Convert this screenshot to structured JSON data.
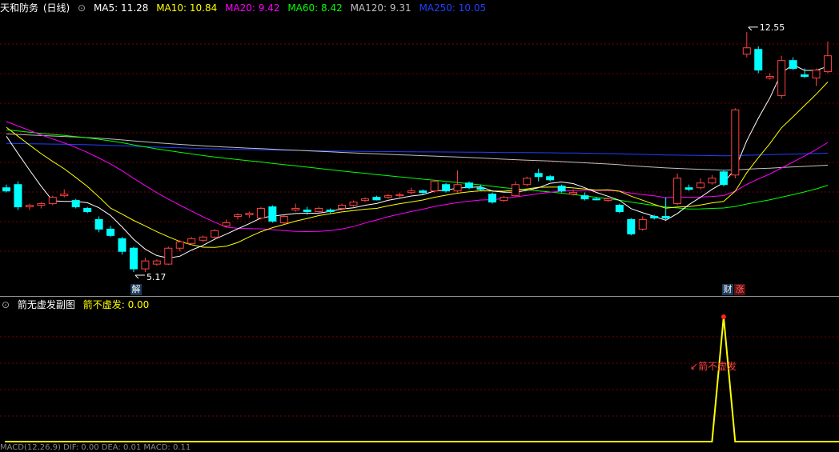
{
  "header": {
    "stock_name": "天和防务",
    "period": "(日线)",
    "ma_items": [
      {
        "label": "MA5: 11.28",
        "color": "#ffffff"
      },
      {
        "label": "MA10: 10.84",
        "color": "#ffff00"
      },
      {
        "label": "MA20: 9.42",
        "color": "#ff00ff"
      },
      {
        "label": "MA60: 8.42",
        "color": "#00ff00"
      },
      {
        "label": "MA120: 9.31",
        "color": "#c0c0c0"
      },
      {
        "label": "MA250: 10.05",
        "color": "#2040ff"
      }
    ]
  },
  "annotations": {
    "high_label": "12.55",
    "low_label": "5.17",
    "tag_jie": "解",
    "tag_cai": "财",
    "tag_zhang": "涨"
  },
  "sub_header": {
    "indicator_name": "箭无虚发副图",
    "value_label": "箭不虚发: 0.00",
    "signal_label": "箭不虚发"
  },
  "footer": {
    "text": "MACD(12,26,9)  DIF: 0.00  DEA: 0.01  MACD: 0.11"
  },
  "colors": {
    "up": "#ff4040",
    "down": "#00ffff",
    "grid": "#7a0000",
    "signal": "#ffff00"
  },
  "chart_data": {
    "type": "candlestick",
    "price_range": [
      4.7,
      13.0
    ],
    "ohlc": [
      [
        7.6,
        7.7,
        7.45,
        7.5
      ],
      [
        7.7,
        7.8,
        6.9,
        7.0
      ],
      [
        7.0,
        7.1,
        6.9,
        7.05
      ],
      [
        7.05,
        7.15,
        6.95,
        7.1
      ],
      [
        7.1,
        7.35,
        7.05,
        7.3
      ],
      [
        7.35,
        7.55,
        7.3,
        7.4
      ],
      [
        7.2,
        7.25,
        6.95,
        7.0
      ],
      [
        6.95,
        7.0,
        6.8,
        6.85
      ],
      [
        6.6,
        6.7,
        6.2,
        6.3
      ],
      [
        6.3,
        6.4,
        6.05,
        6.1
      ],
      [
        6.0,
        6.05,
        5.5,
        5.6
      ],
      [
        5.7,
        5.75,
        4.95,
        5.05
      ],
      [
        5.05,
        5.4,
        4.95,
        5.3
      ],
      [
        5.2,
        5.35,
        5.15,
        5.3
      ],
      [
        5.2,
        5.75,
        5.17,
        5.7
      ],
      [
        5.7,
        5.95,
        5.6,
        5.9
      ],
      [
        5.85,
        6.05,
        5.8,
        6.0
      ],
      [
        5.95,
        6.1,
        5.9,
        6.05
      ],
      [
        6.05,
        6.3,
        6.0,
        6.25
      ],
      [
        6.4,
        6.6,
        6.35,
        6.5
      ],
      [
        6.7,
        6.8,
        6.6,
        6.75
      ],
      [
        6.75,
        6.85,
        6.65,
        6.8
      ],
      [
        6.65,
        7.0,
        6.6,
        6.95
      ],
      [
        7.0,
        7.05,
        6.5,
        6.55
      ],
      [
        6.5,
        6.75,
        6.45,
        6.7
      ],
      [
        6.9,
        7.1,
        6.85,
        6.95
      ],
      [
        6.9,
        7.0,
        6.75,
        6.85
      ],
      [
        6.85,
        7.0,
        6.8,
        6.95
      ],
      [
        6.9,
        6.95,
        6.8,
        6.85
      ],
      [
        6.95,
        7.1,
        6.9,
        7.05
      ],
      [
        7.05,
        7.2,
        7.0,
        7.15
      ],
      [
        7.2,
        7.3,
        7.15,
        7.25
      ],
      [
        7.3,
        7.35,
        7.2,
        7.22
      ],
      [
        7.3,
        7.4,
        7.25,
        7.35
      ],
      [
        7.35,
        7.45,
        7.3,
        7.38
      ],
      [
        7.45,
        7.6,
        7.4,
        7.5
      ],
      [
        7.5,
        7.55,
        7.4,
        7.45
      ],
      [
        7.5,
        7.85,
        7.45,
        7.8
      ],
      [
        7.7,
        7.75,
        7.45,
        7.5
      ],
      [
        7.5,
        8.15,
        7.45,
        7.7
      ],
      [
        7.75,
        7.8,
        7.55,
        7.6
      ],
      [
        7.6,
        7.7,
        7.5,
        7.55
      ],
      [
        7.4,
        7.45,
        7.1,
        7.15
      ],
      [
        7.2,
        7.35,
        7.15,
        7.3
      ],
      [
        7.35,
        7.8,
        7.3,
        7.7
      ],
      [
        7.7,
        7.95,
        7.65,
        7.9
      ],
      [
        8.05,
        8.2,
        7.8,
        7.95
      ],
      [
        7.95,
        8.0,
        7.8,
        7.85
      ],
      [
        7.65,
        7.7,
        7.45,
        7.5
      ],
      [
        7.4,
        7.55,
        7.35,
        7.45
      ],
      [
        7.35,
        7.45,
        7.2,
        7.25
      ],
      [
        7.25,
        7.3,
        7.2,
        7.22
      ],
      [
        7.2,
        7.3,
        7.15,
        7.25
      ],
      [
        7.05,
        7.1,
        6.8,
        6.85
      ],
      [
        6.6,
        6.65,
        6.1,
        6.15
      ],
      [
        6.3,
        6.7,
        6.25,
        6.6
      ],
      [
        6.7,
        6.75,
        6.6,
        6.65
      ],
      [
        6.7,
        7.3,
        6.6,
        6.65
      ],
      [
        7.1,
        8.05,
        7.05,
        7.9
      ],
      [
        7.6,
        7.7,
        7.5,
        7.55
      ],
      [
        7.6,
        7.9,
        7.55,
        7.75
      ],
      [
        7.75,
        8.0,
        7.7,
        7.9
      ],
      [
        8.1,
        8.15,
        7.65,
        7.7
      ],
      [
        8.0,
        10.1,
        7.9,
        10.05
      ],
      [
        11.8,
        12.5,
        11.7,
        12.0
      ],
      [
        11.95,
        12.05,
        11.2,
        11.3
      ],
      [
        11.05,
        11.2,
        11.0,
        11.1
      ],
      [
        10.5,
        11.75,
        10.4,
        11.6
      ],
      [
        11.6,
        11.7,
        11.3,
        11.35
      ],
      [
        11.15,
        11.35,
        11.05,
        11.1
      ],
      [
        11.05,
        11.35,
        10.8,
        11.3
      ],
      [
        11.25,
        12.2,
        11.2,
        11.75
      ]
    ],
    "moving_averages": [
      {
        "name": "MA5",
        "color": "#ffffff"
      },
      {
        "name": "MA10",
        "color": "#ffff00"
      },
      {
        "name": "MA20",
        "color": "#ff00ff"
      },
      {
        "name": "MA60",
        "color": "#00ff00"
      },
      {
        "name": "MA120",
        "color": "#c0c0c0"
      },
      {
        "name": "MA250",
        "color": "#2040ff"
      }
    ],
    "indicator": {
      "name": "箭不虚发",
      "range": [
        0,
        1
      ],
      "values": [
        0,
        0,
        0,
        0,
        0,
        0,
        0,
        0,
        0,
        0,
        0,
        0,
        0,
        0,
        0,
        0,
        0,
        0,
        0,
        0,
        0,
        0,
        0,
        0,
        0,
        0,
        0,
        0,
        0,
        0,
        0,
        0,
        0,
        0,
        0,
        0,
        0,
        0,
        0,
        0,
        0,
        0,
        0,
        0,
        0,
        0,
        0,
        0,
        0,
        0,
        0,
        0,
        0,
        0,
        0,
        0,
        0,
        0,
        0,
        0,
        0,
        0,
        1,
        0,
        0,
        0,
        0,
        0,
        0,
        0,
        0,
        0,
        0,
        0,
        0,
        0
      ]
    }
  }
}
